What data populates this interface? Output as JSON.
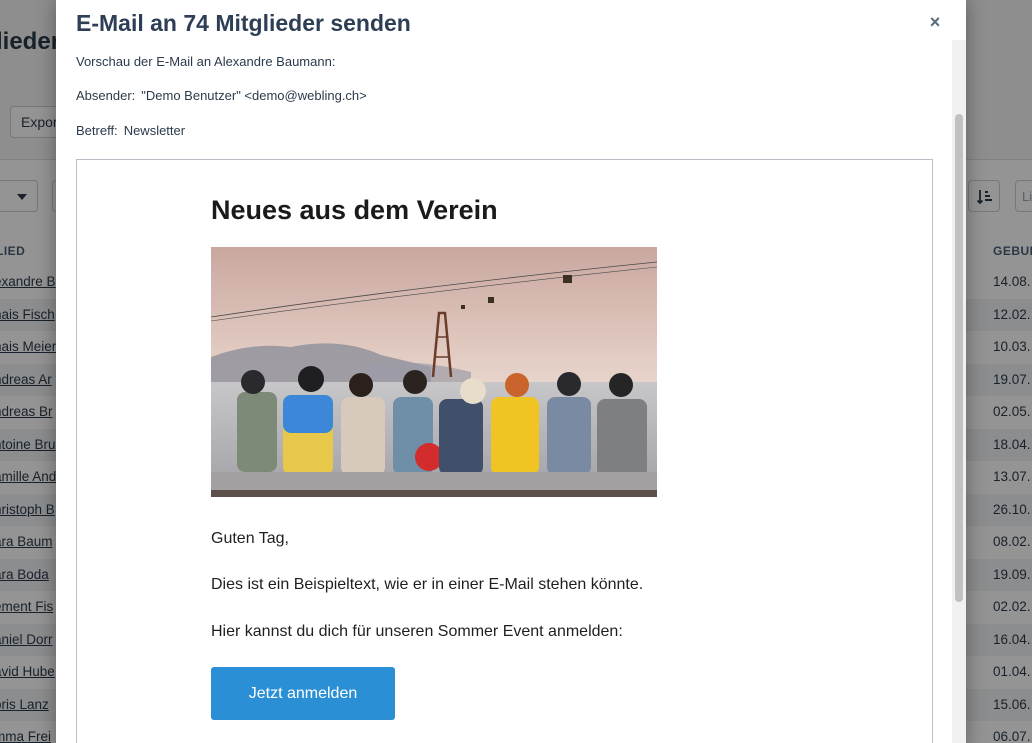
{
  "background": {
    "page_title": "lieder",
    "export_label": "Expor",
    "search_placeholder": "Li",
    "col_member": "LIED",
    "col_birth": "GEBUR",
    "rows": [
      {
        "name": "exandre B",
        "date": "14.08."
      },
      {
        "name": "nais Fisch",
        "date": "12.02."
      },
      {
        "name": "nais Meier",
        "date": "10.03."
      },
      {
        "name": "ndreas Ar",
        "date": "19.07."
      },
      {
        "name": "ndreas Br",
        "date": "02.05."
      },
      {
        "name": "ntoine Bru",
        "date": "18.04."
      },
      {
        "name": "amille And",
        "date": "13.07."
      },
      {
        "name": "nristoph B",
        "date": "26.10."
      },
      {
        "name": "ara Baum",
        "date": "08.02."
      },
      {
        "name": "ara Boda",
        "date": "19.09."
      },
      {
        "name": "ement Fis",
        "date": "02.02."
      },
      {
        "name": "aniel Dorr",
        "date": "16.04."
      },
      {
        "name": "avid Hube",
        "date": "01.04."
      },
      {
        "name": "oris Lanz",
        "date": "15.06."
      },
      {
        "name": "mma Frei",
        "date": "06.07."
      }
    ]
  },
  "modal": {
    "title": "E-Mail an 74 Mitglieder senden",
    "close_icon": "×",
    "preview_line": "Vorschau der E-Mail an Alexandre Baumann:",
    "sender_label": "Absender:",
    "sender_value": "\"Demo Benutzer\" <demo@webling.ch>",
    "subject_label": "Betreff:",
    "subject_value": "Newsletter"
  },
  "email": {
    "heading": "Neues aus dem Verein",
    "greeting": "Guten Tag,",
    "body1": "Dies ist ein Beispieltext, wie er in einer E-Mail stehen könnte.",
    "body2": "Hier kannst du dich für unseren Sommer Event anmelden:",
    "cta_label": "Jetzt anmelden"
  },
  "colors": {
    "accent": "#2a8fd4",
    "title": "#2e3f55"
  }
}
